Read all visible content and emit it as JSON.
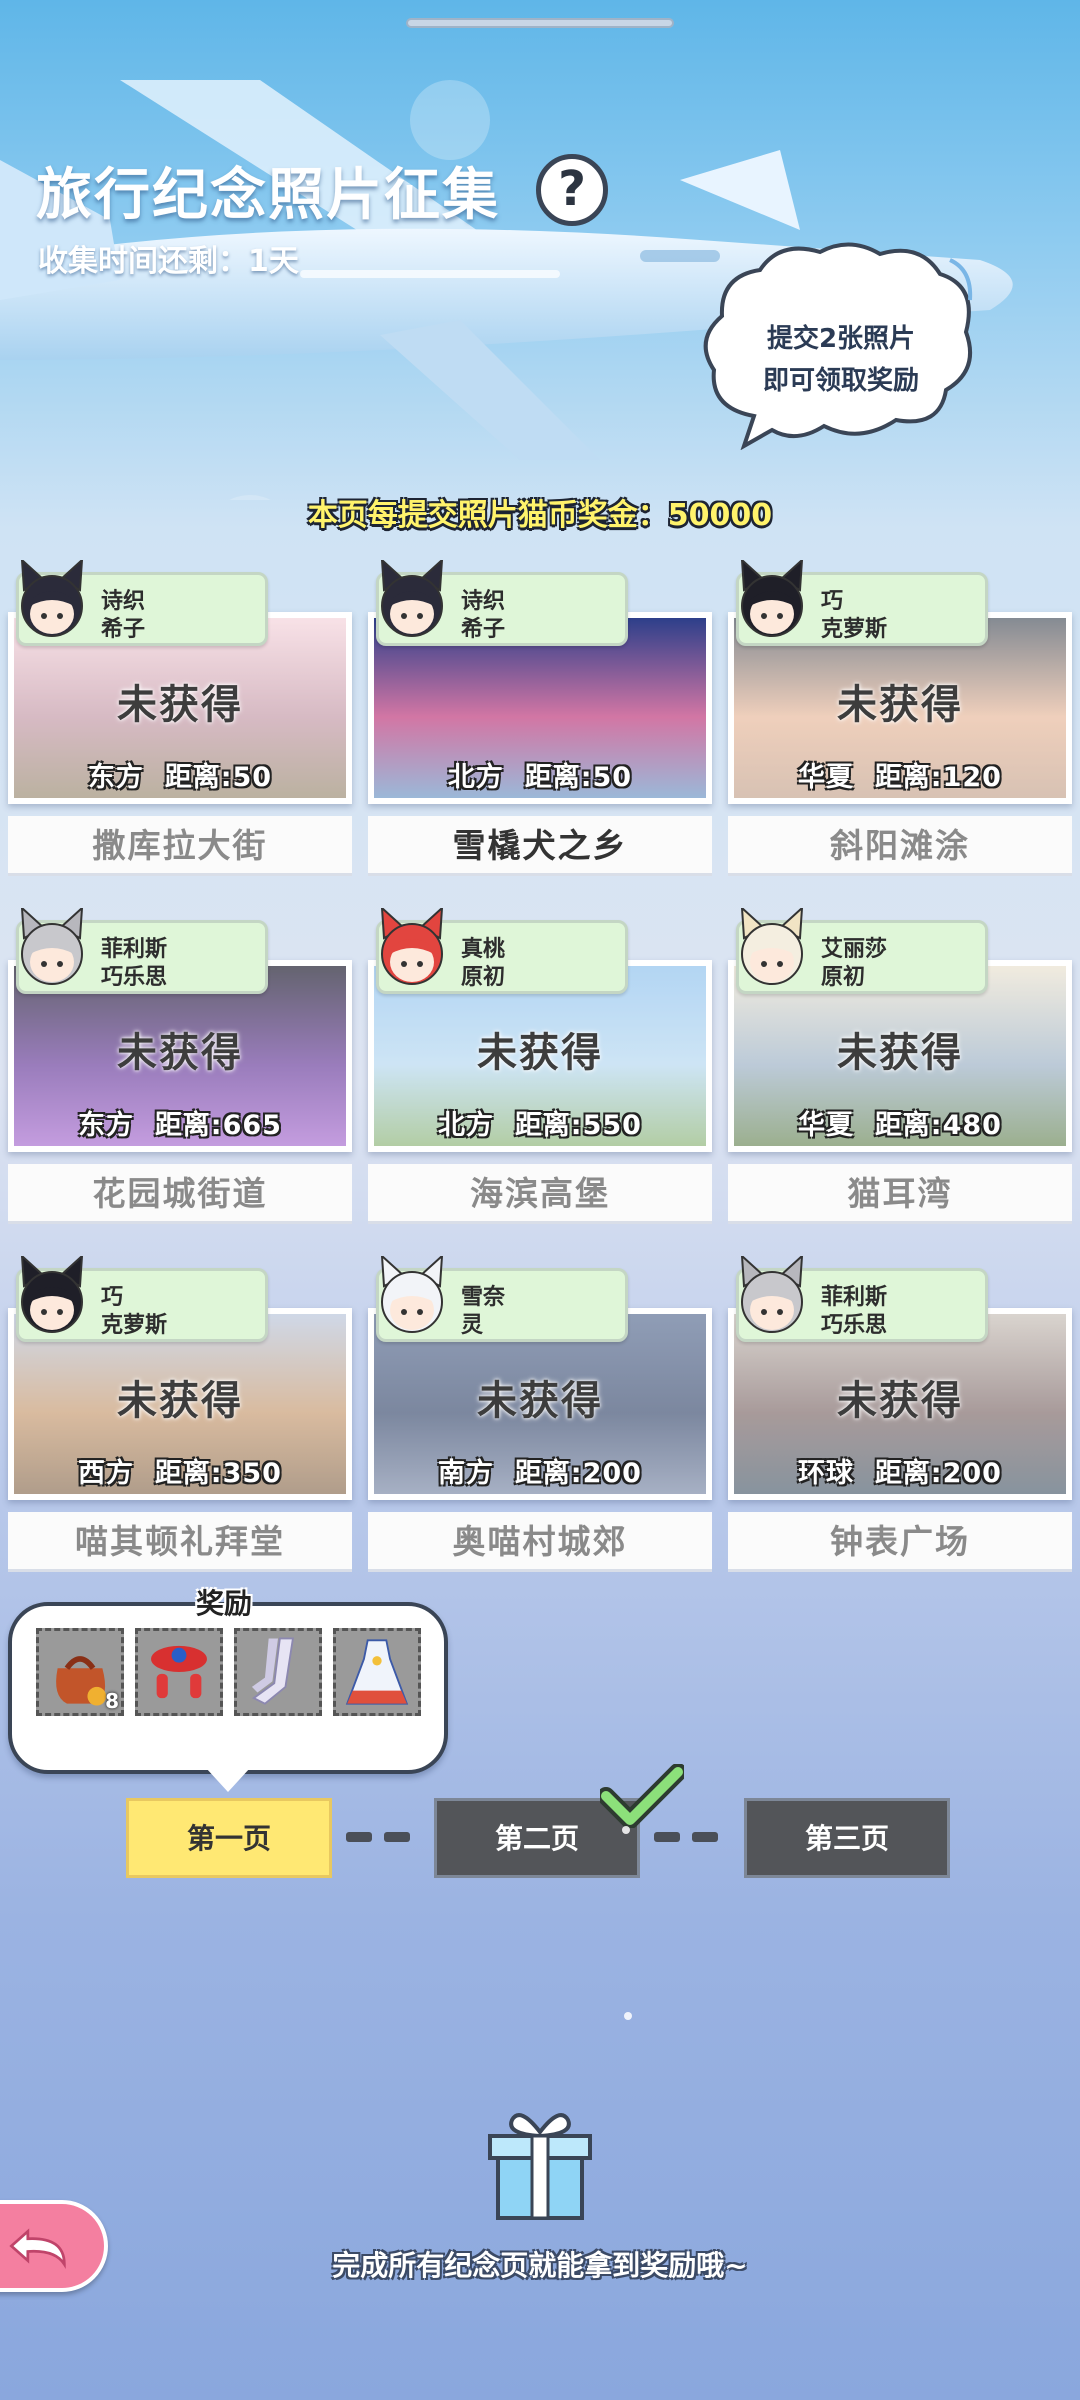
{
  "header": {
    "title": "旅行纪念照片征集",
    "help_icon": "?",
    "countdown": "收集时间还剩：1天",
    "bubble_line1": "提交2张照片",
    "bubble_line2": "即可领取奖励",
    "reward_line": "本页每提交照片猫币奖金：50000"
  },
  "cards": [
    {
      "char1": "诗织",
      "char2": "希子",
      "status": "未获得",
      "dir": "东方",
      "distance": "距离:50",
      "name": "撒库拉大街",
      "done": false,
      "hair": "#2b2b3a",
      "ear": "#2b2b3a"
    },
    {
      "char1": "诗织",
      "char2": "希子",
      "status": "",
      "dir": "北方",
      "distance": "距离:50",
      "name": "雪橇犬之乡",
      "done": true,
      "hair": "#2b2b3a",
      "ear": "#2b2b3a"
    },
    {
      "char1": "巧",
      "char2": "克萝斯",
      "status": "未获得",
      "dir": "华夏",
      "distance": "距离:120",
      "name": "斜阳滩涂",
      "done": false,
      "hair": "#1f1f28",
      "ear": "#1f1f28"
    },
    {
      "char1": "菲利斯",
      "char2": "巧乐思",
      "status": "未获得",
      "dir": "东方",
      "distance": "距离:665",
      "name": "花园城街道",
      "done": false,
      "hair": "#c8c8cc",
      "ear": "#b7b7bd"
    },
    {
      "char1": "真桃",
      "char2": "原初",
      "status": "未获得",
      "dir": "北方",
      "distance": "距离:550",
      "name": "海滨高堡",
      "done": false,
      "hair": "#e2453f",
      "ear": "#e2453f"
    },
    {
      "char1": "艾丽莎",
      "char2": "原初",
      "status": "未获得",
      "dir": "华夏",
      "distance": "距离:480",
      "name": "猫耳湾",
      "done": false,
      "hair": "#f4eee0",
      "ear": "#f1e4c4"
    },
    {
      "char1": "巧",
      "char2": "克萝斯",
      "status": "未获得",
      "dir": "西方",
      "distance": "距离:350",
      "name": "喵其顿礼拜堂",
      "done": false,
      "hair": "#1f1f28",
      "ear": "#1f1f28"
    },
    {
      "char1": "雪奈",
      "char2": "灵",
      "status": "未获得",
      "dir": "南方",
      "distance": "距离:200",
      "name": "奥喵村城郊",
      "done": false,
      "hair": "#f2f4f8",
      "ear": "#f2f4f8"
    },
    {
      "char1": "菲利斯",
      "char2": "巧乐思",
      "status": "未获得",
      "dir": "环球",
      "distance": "距离:200",
      "name": "钟表广场",
      "done": false,
      "hair": "#c8c8cc",
      "ear": "#b7b7bd"
    }
  ],
  "rewards": {
    "title": "奖励",
    "items": [
      {
        "icon": "bag-icon",
        "count": "8"
      },
      {
        "icon": "ornament-icon",
        "count": ""
      },
      {
        "icon": "stockings-icon",
        "count": ""
      },
      {
        "icon": "dress-icon",
        "count": ""
      }
    ]
  },
  "pages": {
    "page1": "第一页",
    "page2": "第二页",
    "page3": "第三页",
    "active": "page1",
    "completed": "page2"
  },
  "footer": {
    "note": "完成所有纪念页就能拿到奖励哦~"
  },
  "colors": {
    "tab_bg": "#dff6d8",
    "active_page": "#ffe873",
    "inactive_page": "#535559",
    "back_button": "#f47fa0",
    "check": "#8ce07a"
  }
}
